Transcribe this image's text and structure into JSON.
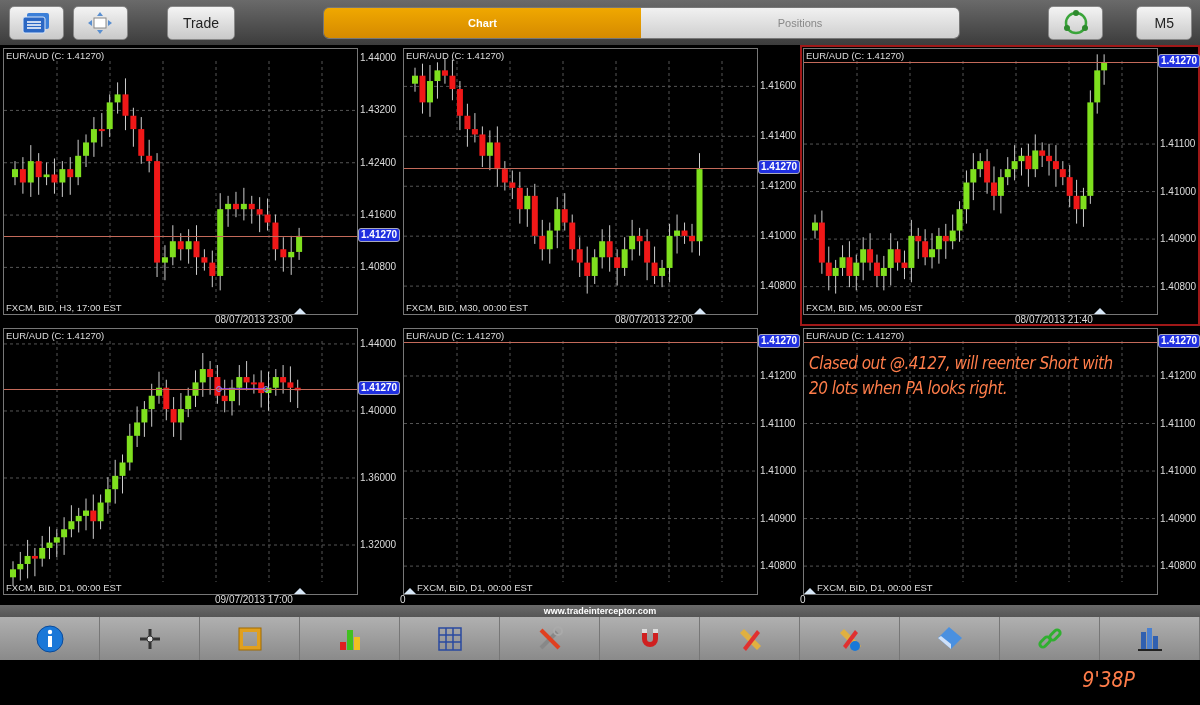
{
  "top_bar": {
    "trade_button": "Trade",
    "tabs": [
      {
        "label": "Chart",
        "selected": true
      },
      {
        "label": "Positions",
        "selected": false
      }
    ],
    "timeframe_button": "M5"
  },
  "panels": [
    {
      "kind": "candles",
      "selected": false,
      "title": "EUR/AUD (C: 1.41270)",
      "source": "FXCM, BID, H3, 17:00 EST",
      "x_label": "08/07/2013 23:00",
      "price_tag": "1.41270",
      "y_ticks": [
        "1.44000",
        "1.43200",
        "1.42400",
        "1.41600",
        "1.40800"
      ]
    },
    {
      "kind": "candles",
      "selected": false,
      "title": "EUR/AUD (C: 1.41270)",
      "source": "FXCM, BID, M30, 00:00 EST",
      "x_label": "08/07/2013 22:00",
      "price_tag": "1.41270",
      "y_ticks": [
        "1.41600",
        "1.41400",
        "1.41200",
        "1.41000",
        "1.40800"
      ]
    },
    {
      "kind": "candles",
      "selected": true,
      "title": "EUR/AUD (C: 1.41270)",
      "source": "FXCM, BID, M5, 00:00 EST",
      "x_label": "08/07/2013 21:40",
      "price_tag": "1.41270",
      "y_ticks": [
        "1.41100",
        "1.41000",
        "1.40900",
        "1.40800"
      ]
    },
    {
      "kind": "candles",
      "selected": false,
      "title": "EUR/AUD (C: 1.41270)",
      "source": "FXCM, BID, D1, 00:00 EST",
      "x_label": "09/07/2013 17:00",
      "price_tag": "1.41270",
      "y_ticks": [
        "1.44000",
        "1.40000",
        "1.36000",
        "1.32000"
      ]
    },
    {
      "kind": "empty",
      "selected": false,
      "title": "EUR/AUD (C: 1.41270)",
      "source": "FXCM, BID, D1, 00:00 EST",
      "x_label": "0",
      "price_tag": "1.41270",
      "y_ticks": [
        "1.41200",
        "1.41100",
        "1.41000",
        "1.40900",
        "1.40800"
      ]
    },
    {
      "kind": "empty",
      "selected": false,
      "title": "EUR/AUD (C: 1.41270)",
      "source": "FXCM, BID, D1, 00:00 EST",
      "x_label": "0",
      "price_tag": "1.41270",
      "y_ticks": [
        "1.41200",
        "1.41100",
        "1.41000",
        "1.40900",
        "1.40800"
      ],
      "note": "Clased out @.4127, will reenter Short with 20 lots when PA looks right."
    }
  ],
  "website": "www.tradeinterceptor.com",
  "clock": "9'38P"
}
